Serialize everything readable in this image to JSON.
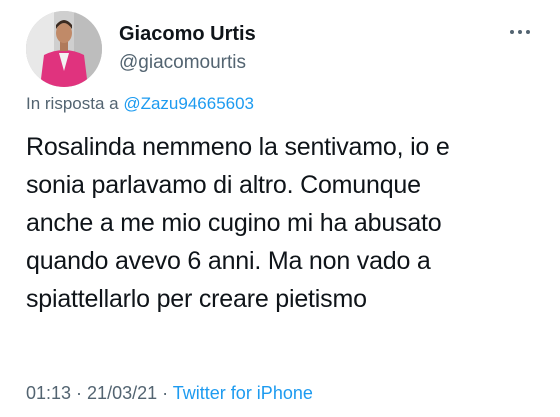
{
  "author": {
    "display_name": "Giacomo Urtis",
    "handle": "@giacomourtis"
  },
  "more_menu": {
    "icon": "more-horizontal-icon"
  },
  "reply_context": {
    "prefix": "In risposta a ",
    "mention": "@Zazu94665603"
  },
  "tweet": {
    "lines": [
      "Rosalinda nemmeno la sentivamo, io e",
      "sonia parlavamo di altro. Comunque",
      "anche a me mio cugino mi ha abusato",
      "quando avevo 6 anni. Ma non vado a",
      "spiattellarlo per creare pietismo"
    ]
  },
  "meta": {
    "time": "01:13",
    "separator1": " · ",
    "date": "21/03/21",
    "separator2": " · ",
    "source": "Twitter for iPhone"
  },
  "colors": {
    "link": "#1d9bf0",
    "secondary_text": "#536471",
    "primary_text": "#0f1419",
    "avatar_suit": "#e0337e"
  }
}
